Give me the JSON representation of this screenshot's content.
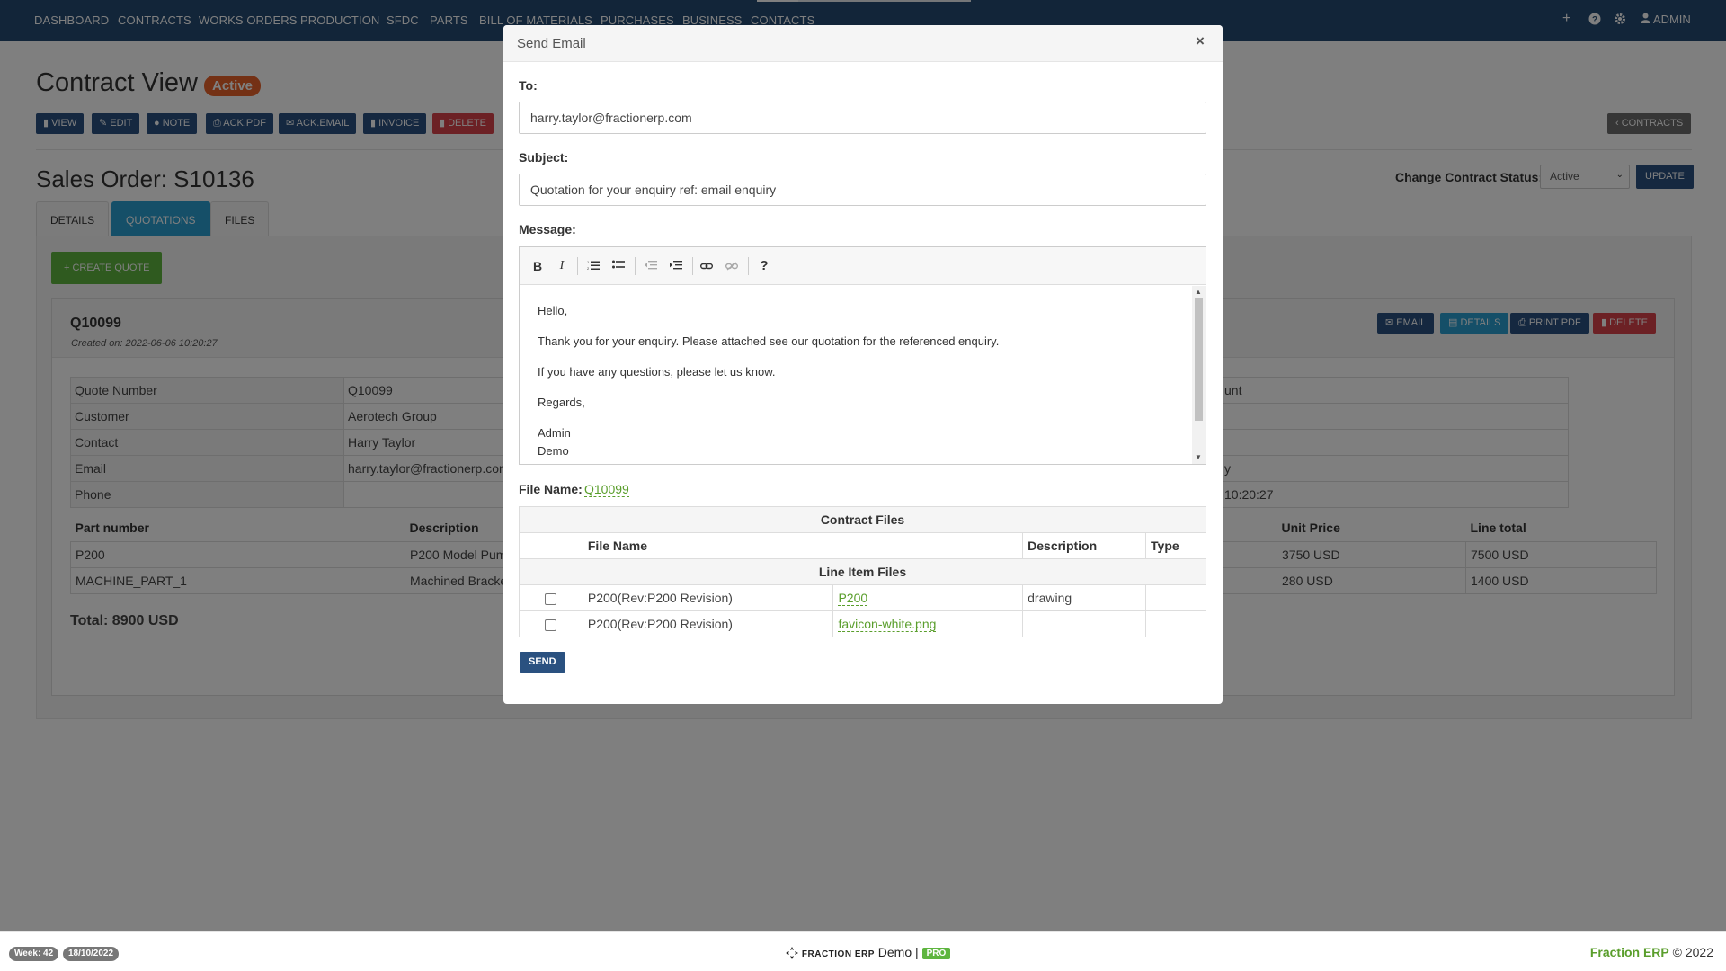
{
  "nav": {
    "items": [
      "DASHBOARD",
      "CONTRACTS",
      "WORKS ORDERS",
      "PRODUCTION",
      "SFDC",
      "PARTS",
      "BILL OF MATERIALS",
      "PURCHASES",
      "BUSINESS",
      "CONTACTS"
    ],
    "admin_label": "ADMIN",
    "icons": [
      "plus-icon",
      "help-icon",
      "gear-icon",
      "user-icon"
    ]
  },
  "page": {
    "title": "Contract View",
    "status_badge": "Active",
    "toolbar": [
      "VIEW",
      "EDIT",
      "NOTE",
      "ACK.PDF",
      "ACK.EMAIL",
      "INVOICE",
      "DELETE"
    ],
    "contracts_button": "CONTRACTS",
    "sales_order_title": "Sales Order: S10136",
    "change_status_label": "Change Contract Status:",
    "status_value": "Active",
    "update_button": "UPDATE",
    "tabs": [
      "DETAILS",
      "QUOTATIONS",
      "FILES"
    ],
    "active_tab": "QUOTATIONS",
    "create_quote_button": "CREATE QUOTE"
  },
  "quote": {
    "number": "Q10099",
    "created": "Created on: 2022-06-06 10:20:27",
    "buttons": [
      "EMAIL",
      "DETAILS",
      "PRINT PDF",
      "DELETE"
    ],
    "fields": [
      {
        "label": "Quote Number",
        "value": "Q10099"
      },
      {
        "label": "Customer",
        "value": "Aerotech Group"
      },
      {
        "label": "Contact",
        "value": "Harry Taylor"
      },
      {
        "label": "Email",
        "value": "harry.taylor@fractionerp.com"
      },
      {
        "label": "Phone",
        "value": ""
      }
    ],
    "right_fragments": [
      "unt",
      "",
      "",
      "y",
      "10:20:27"
    ],
    "parts_headers": [
      "Part number",
      "Description",
      "Unit Price",
      "Line total"
    ],
    "parts_rows": [
      {
        "part": "P200",
        "description": "P200 Model Pum",
        "unit_price": "3750 USD",
        "line_total": "7500 USD"
      },
      {
        "part": "MACHINE_PART_1",
        "description": "Machined Bracke",
        "unit_price": "280 USD",
        "line_total": "1400 USD"
      }
    ],
    "total": "Total: 8900 USD"
  },
  "modal": {
    "title": "Send Email",
    "close": "×",
    "to_label": "To:",
    "to_value": "harry.taylor@fractionerp.com",
    "subject_label": "Subject:",
    "subject_value": "Quotation for your enquiry ref: email enquiry",
    "message_label": "Message:",
    "message_lines": [
      "Hello,",
      "Thank you for your enquiry. Please attached see our quotation for the referenced enquiry.",
      "If you have any questions, please let us know.",
      "Regards,",
      "Admin",
      "Demo"
    ],
    "editor_tools": [
      "bold-icon",
      "italic-icon",
      "ordered-list-icon",
      "bullet-list-icon",
      "outdent-icon",
      "indent-icon",
      "link-icon",
      "unlink-icon",
      "help-icon"
    ],
    "file_name_label": "File Name:",
    "file_name_value": "Q10099",
    "contract_files_caption": "Contract Files",
    "file_headers": [
      "File Name",
      "Description",
      "Type"
    ],
    "line_item_caption": "Line Item Files",
    "files": [
      {
        "name": "P200(Rev:P200 Revision)",
        "file": "P200",
        "description": "drawing",
        "type": ""
      },
      {
        "name": "P200(Rev:P200 Revision)",
        "file": "favicon-white.png",
        "description": "",
        "type": ""
      }
    ],
    "send_button": "SEND"
  },
  "footer": {
    "week": "Week: 42",
    "date": "18/10/2022",
    "brand": "FRACTION ERP",
    "demo": "Demo",
    "separator": "|",
    "pro": "PRO",
    "right_brand": "Fraction ERP",
    "copyright": "© 2022"
  },
  "colors": {
    "navbar": "#244a72",
    "accent_green": "#5eb53f",
    "link_green": "#5a9e2c",
    "danger": "#d9434a",
    "tab_active": "#2a9fd0",
    "badge_active": "#e8622a"
  }
}
